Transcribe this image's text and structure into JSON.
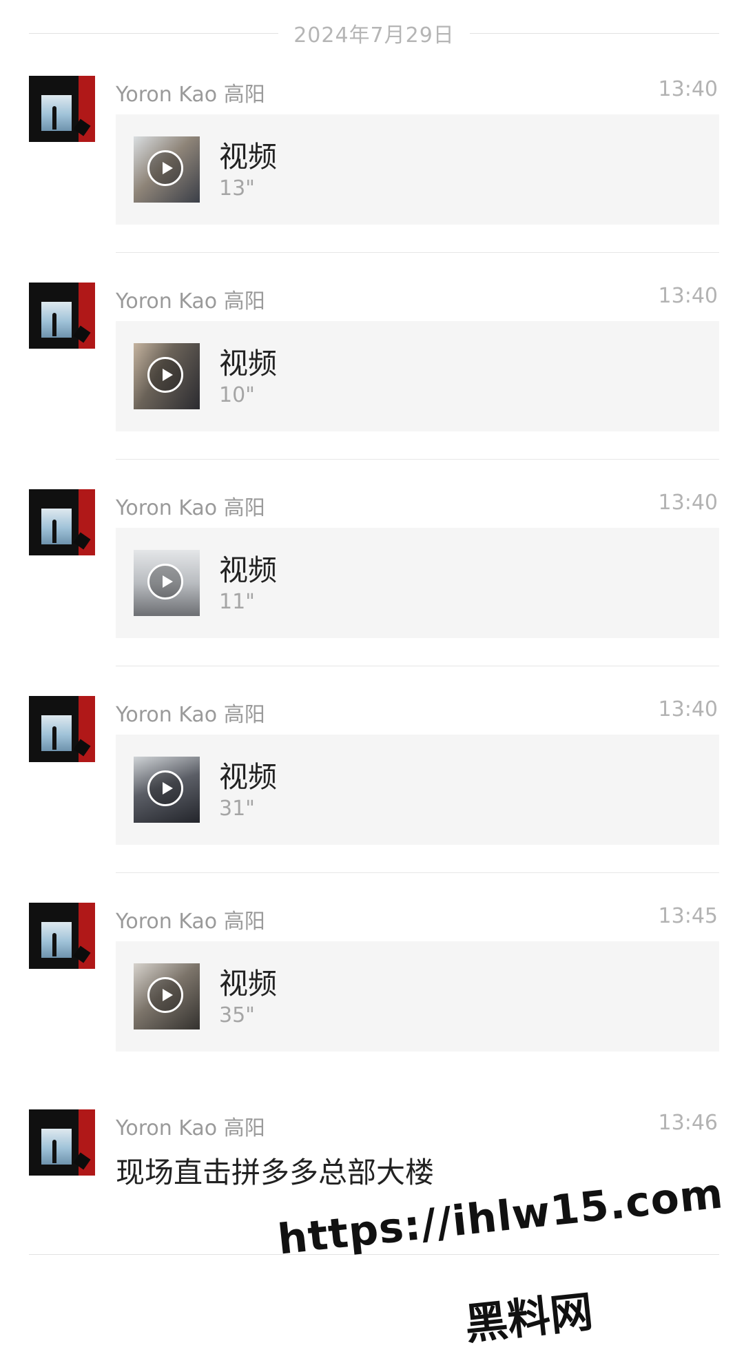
{
  "date_separator": "2024年7月29日",
  "messages": [
    {
      "sender": "Yoron Kao 高阳",
      "time": "13:40",
      "type": "video",
      "title": "视频",
      "duration": "13\""
    },
    {
      "sender": "Yoron Kao 高阳",
      "time": "13:40",
      "type": "video",
      "title": "视频",
      "duration": "10\""
    },
    {
      "sender": "Yoron Kao 高阳",
      "time": "13:40",
      "type": "video",
      "title": "视频",
      "duration": "11\""
    },
    {
      "sender": "Yoron Kao 高阳",
      "time": "13:40",
      "type": "video",
      "title": "视频",
      "duration": "31\""
    },
    {
      "sender": "Yoron Kao 高阳",
      "time": "13:45",
      "type": "video",
      "title": "视频",
      "duration": "35\""
    },
    {
      "sender": "Yoron Kao 高阳",
      "time": "13:46",
      "type": "text",
      "text": "现场直击拼多多总部大楼"
    }
  ],
  "watermark": {
    "url": "https://ihlw15.com",
    "name": "黑料网"
  },
  "colors": {
    "card_background": "#f5f5f5",
    "meta_text": "#9a9a9a",
    "avatar_accent": "#b01818"
  }
}
